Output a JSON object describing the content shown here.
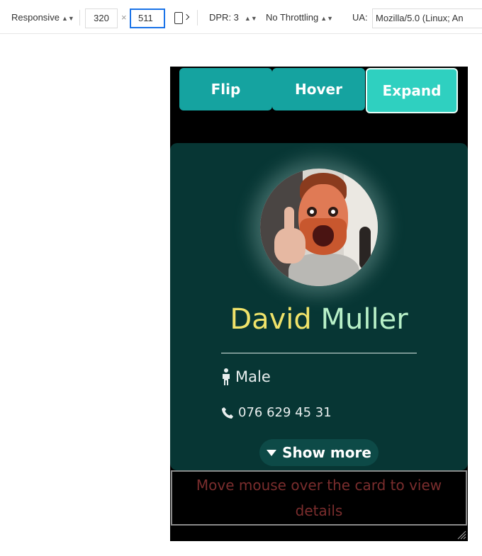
{
  "devtools": {
    "device_mode": "Responsive",
    "width": "320",
    "height_separator": "×",
    "height": "511",
    "dpr": "DPR: 3",
    "throttling": "No Throttling",
    "ua_label": "UA:",
    "ua_value": "Mozilla/5.0 (Linux; An"
  },
  "buttons": {
    "flip": "Flip",
    "hover": "Hover",
    "expand": "Expand"
  },
  "card": {
    "first_name": "David",
    "last_name": "Muller",
    "gender": "Male",
    "phone": "076 629 45 31",
    "show_more": "Show more"
  },
  "hint": "Move mouse over the card to view details",
  "colors": {
    "button": "#15a3a0",
    "button_active": "#2fd0c0",
    "card_bg": "#073634",
    "name_first": "#f0e36a",
    "name_last": "#b8f0c8",
    "hint_text": "#7a2d2d"
  }
}
